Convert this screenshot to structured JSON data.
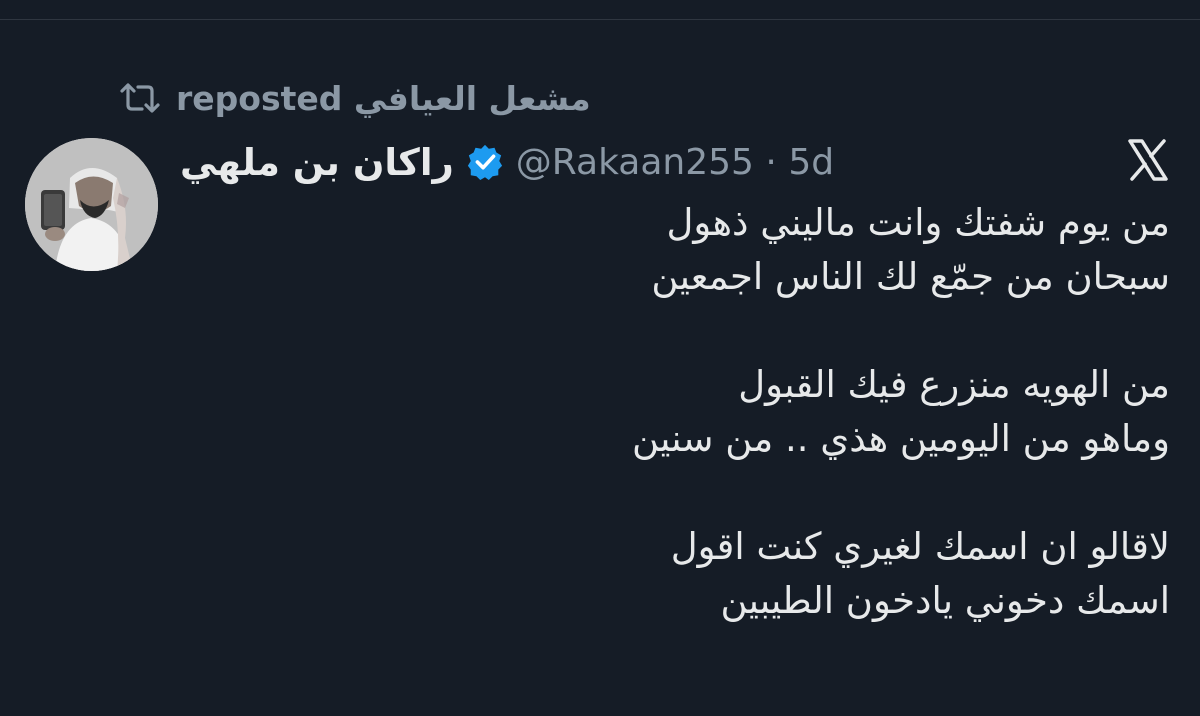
{
  "repost": {
    "reposter_name": "مشعل العيافي",
    "label": "reposted",
    "icon": "repost-icon"
  },
  "author": {
    "display_name": "راكان بن ملهي",
    "verified_icon": "verified-badge-icon",
    "handle": "@Rakaan255",
    "separator": "·",
    "time": "5d"
  },
  "brand": {
    "logo": "x-logo-icon"
  },
  "tweet": {
    "lines": [
      "من يوم شفتك وانت ماليني ذهول",
      "سبحان من جمّع لك الناس اجمعين",
      "",
      "من الهويه منزرع فيك القبول",
      "وماهو من اليومين هذي .. من سنين",
      "",
      "لاقالو ان اسمك لغيري كنت اقول",
      "اسمك دخوني يادخون الطيبين"
    ]
  },
  "colors": {
    "background": "#151c26",
    "text_primary": "#e7e9ea",
    "text_secondary": "#8b98a5",
    "verified": "#1d9bf0"
  }
}
